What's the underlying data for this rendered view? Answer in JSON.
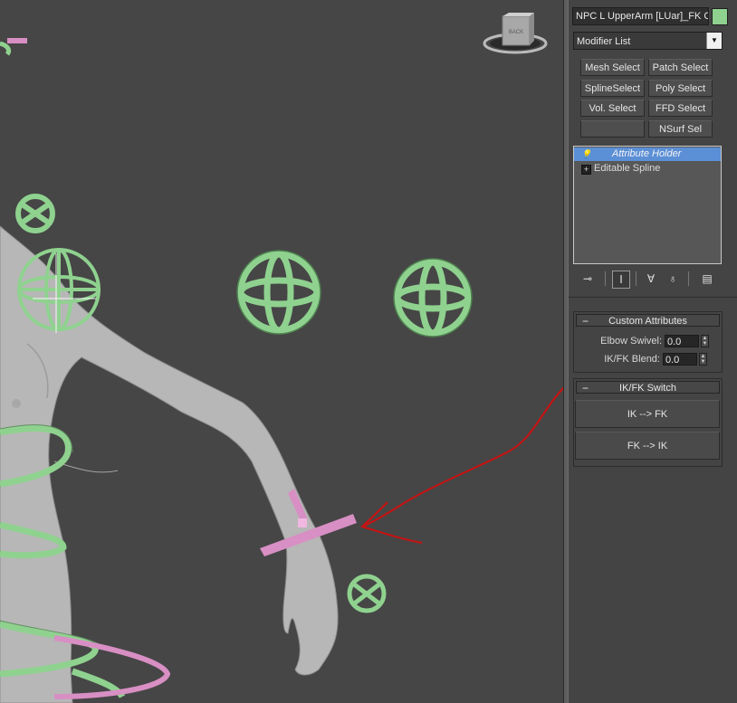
{
  "viewport": {
    "viewcube_label": "BACK",
    "colors": {
      "background": "#464646",
      "control_green": "#8fd28f",
      "control_pink": "#d88fc4",
      "annotation_red": "#cc1111",
      "mesh_gray": "#bdbdbd"
    }
  },
  "panel": {
    "object_name": "NPC L UpperArm [LUar]_FK C",
    "object_color": "#8fd28f",
    "modifier_list": {
      "label": "Modifier List",
      "arrow_icon": "dropdown-arrow-icon"
    },
    "modifier_buttons": [
      {
        "label": "Mesh Select"
      },
      {
        "label": "Patch Select"
      },
      {
        "label": "SplineSelect"
      },
      {
        "label": "Poly Select"
      },
      {
        "label": "Vol. Select"
      },
      {
        "label": "FFD Select"
      },
      {
        "label": ""
      },
      {
        "label": "NSurf Sel"
      }
    ],
    "stack": [
      {
        "label": "Attribute Holder",
        "selected": true,
        "icon": "lightbulb-icon"
      },
      {
        "label": "Editable Spline",
        "selected": false,
        "icon": "expand-plus-icon"
      }
    ],
    "stack_tools": [
      "pin-stack-icon",
      "show-end-result-icon",
      "make-unique-icon",
      "remove-modifier-icon",
      "configure-sets-icon"
    ],
    "custom_attributes": {
      "title": "Custom Attributes",
      "collapse_symbol": "−",
      "fields": [
        {
          "label": "Elbow Swivel:",
          "value": "0.0"
        },
        {
          "label": "IK/FK Blend:",
          "value": "0.0"
        }
      ]
    },
    "ikfk_switch": {
      "title": "IK/FK Switch",
      "collapse_symbol": "−",
      "buttons": [
        {
          "label": "IK --> FK"
        },
        {
          "label": "FK --> IK"
        }
      ]
    }
  }
}
